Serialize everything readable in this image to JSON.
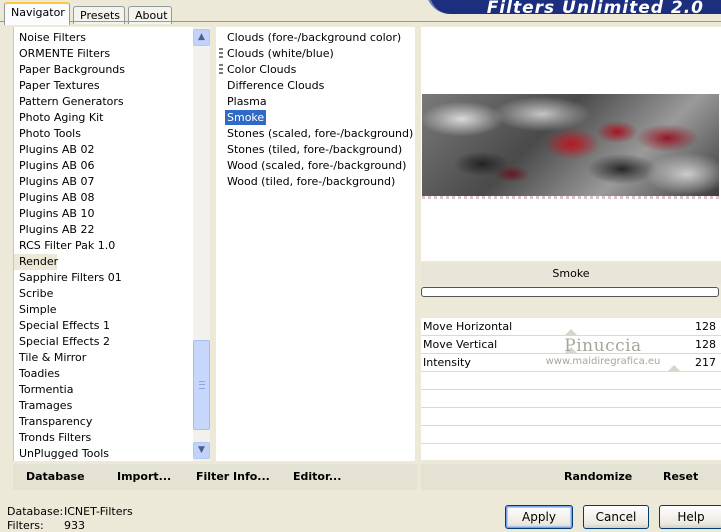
{
  "app": {
    "title": "Filters Unlimited 2.0",
    "tabs": [
      "Navigator",
      "Presets",
      "About"
    ],
    "active_tab": "Navigator"
  },
  "categories": {
    "items": [
      "Noise Filters",
      "ORMENTE Filters",
      "Paper Backgrounds",
      "Paper Textures",
      "Pattern Generators",
      "Photo Aging Kit",
      "Photo Tools",
      "Plugins AB 02",
      "Plugins AB 06",
      "Plugins AB 07",
      "Plugins AB 08",
      "Plugins AB 10",
      "Plugins AB 22",
      "RCS Filter Pak 1.0",
      "Render",
      "Sapphire Filters 01",
      "Scribe",
      "Simple",
      "Special Effects 1",
      "Special Effects 2",
      "Tile & Mirror",
      "Toadies",
      "Tormentia",
      "Tramages",
      "Transparency",
      "Tronds Filters",
      "UnPlugged Tools"
    ],
    "selected": "Render",
    "scroll_up_icon": "chevron-up-icon",
    "scroll_down_icon": "chevron-down-icon"
  },
  "filters": {
    "items": [
      "Clouds (fore-/background color)",
      "Clouds (white/blue)",
      "Color Clouds",
      "Difference Clouds",
      "Plasma",
      "Smoke",
      "Stones (scaled, fore-/background)",
      "Stones (tiled, fore-/background)",
      "Wood (scaled, fore-/background)",
      "Wood (tiled, fore-/background)"
    ],
    "selected": "Smoke",
    "grip_rows": [
      1,
      2
    ]
  },
  "preview": {
    "filter_name": "Smoke",
    "progress_fraction": 0
  },
  "parameters": [
    {
      "label": "Move Horizontal",
      "value": "128"
    },
    {
      "label": "Move Vertical",
      "value": "128"
    },
    {
      "label": "Intensity",
      "value": "217"
    }
  ],
  "watermark": {
    "line1": "Pinuccia",
    "line2": "www.maidiregrafica.eu"
  },
  "toolbar": {
    "database": "Database",
    "import": "Import...",
    "filter_info": "Filter Info...",
    "editor": "Editor...",
    "randomize": "Randomize",
    "reset": "Reset"
  },
  "status": {
    "database_label": "Database:",
    "database_value": "ICNET-Filters",
    "filters_label": "Filters:",
    "filters_value": "933"
  },
  "buttons": {
    "apply": "Apply",
    "cancel": "Cancel",
    "help": "Help"
  },
  "colors": {
    "selection": "#316ac5",
    "banner": "#1c2f7f"
  }
}
